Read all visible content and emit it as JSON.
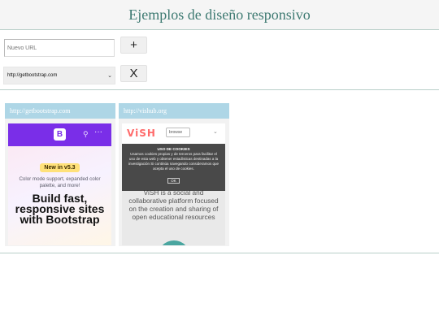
{
  "header": {
    "title": "Ejemplos de diseño responsivo"
  },
  "controls": {
    "url_input_placeholder": "Nuevo URL",
    "add_label": "+",
    "selected_url": "http://getbootstrap.com",
    "remove_label": "X"
  },
  "frames": [
    {
      "url": "http://getbootstrap.com",
      "content": {
        "badge": "New in v5.3",
        "subtitle": "Color mode support, expanded color palette, and more!",
        "headline": "Build fast, responsive sites with Bootstrap"
      }
    },
    {
      "url": "http://vishub.org",
      "content": {
        "logo": "ViSH",
        "browse": "browse",
        "cookie_title": "USO DE COOKIES",
        "cookie_text": "Usamos cookies propias y de terceros para facilitar el uso de esta web y obtener estadísticas destinadas a la investigación Si continúa navegando consideramos que acepta el uso de cookies.",
        "cookie_ok": "OK",
        "hero_text": "ViSH is a social and collaborative platform focused on the creation and sharing of open educational resources"
      }
    }
  ],
  "colors": {
    "title": "#3e7a72",
    "frame_header": "#aed6e6",
    "bootstrap_purple": "#7a2ee8"
  }
}
